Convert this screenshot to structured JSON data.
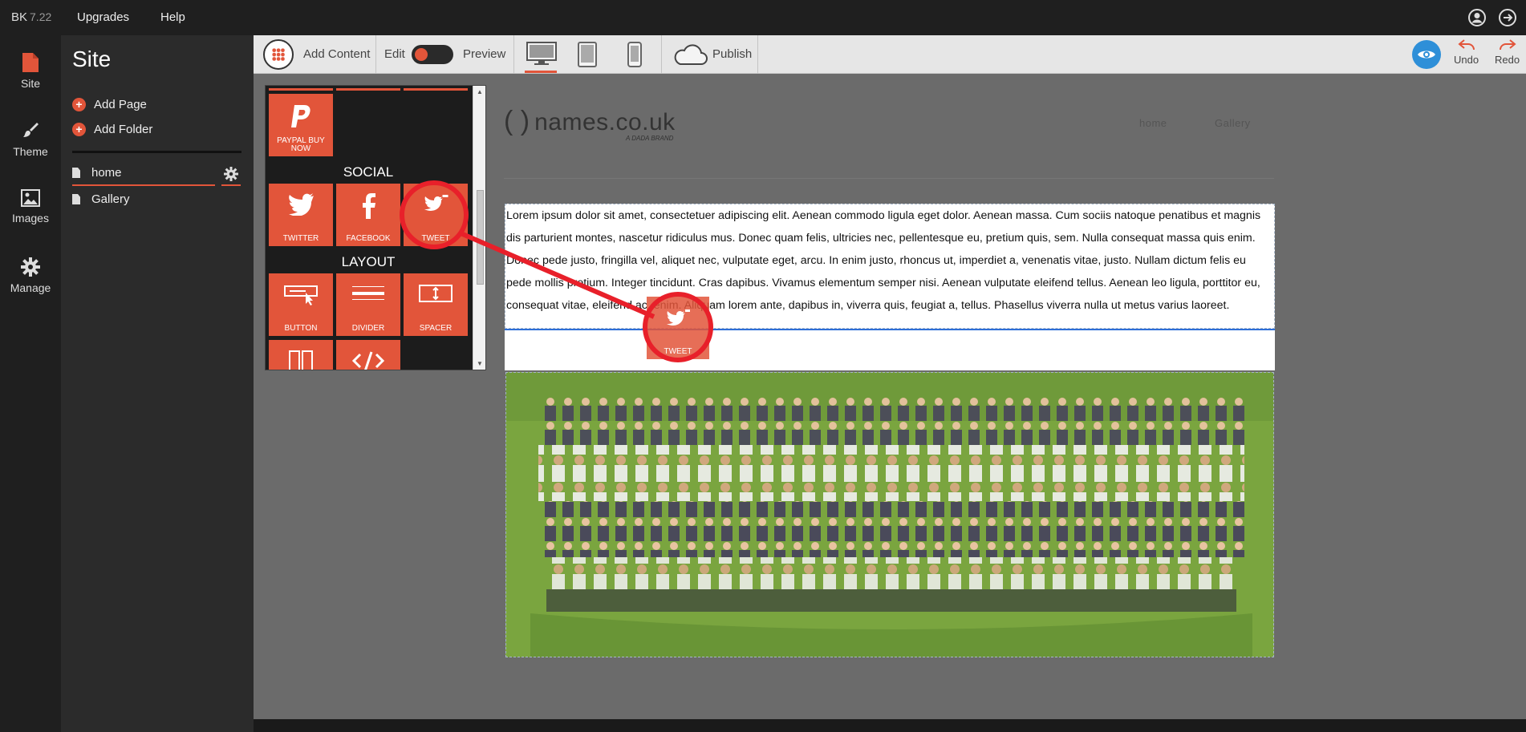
{
  "topbar": {
    "brand": "BK",
    "version": "7.22",
    "menu": [
      "Upgrades",
      "Help"
    ]
  },
  "leftnav": {
    "items": [
      {
        "label": "Site",
        "icon": "site-file-icon"
      },
      {
        "label": "Theme",
        "icon": "brush-icon"
      },
      {
        "label": "Images",
        "icon": "image-icon"
      },
      {
        "label": "Manage",
        "icon": "gear-icon"
      }
    ]
  },
  "site_panel": {
    "title": "Site",
    "add_page": "Add Page",
    "add_folder": "Add Folder",
    "pages": [
      "home",
      "Gallery"
    ]
  },
  "toolbar": {
    "add_content": "Add Content",
    "edit": "Edit",
    "preview": "Preview",
    "publish": "Publish",
    "undo": "Undo",
    "redo": "Redo"
  },
  "palette": {
    "paypal_label": "PAYPAL BUY NOW",
    "social_heading": "SOCIAL",
    "social": [
      "TWITTER",
      "FACEBOOK",
      "TWEET"
    ],
    "layout_heading": "LAYOUT",
    "layout": [
      "BUTTON",
      "DIVIDER",
      "SPACER"
    ]
  },
  "canvas": {
    "logo_text": "names.co.uk",
    "logo_sub": "A DADA BRAND",
    "nav": [
      "home",
      "Gallery"
    ],
    "paragraph": "Lorem ipsum dolor sit amet, consectetuer adipiscing elit. Aenean commodo ligula eget dolor. Aenean massa. Cum sociis natoque penatibus et magnis dis parturient montes, nascetur ridiculus mus. Donec quam felis, ultricies nec, pellentesque eu, pretium quis, sem. Nulla consequat massa quis enim. Donec pede justo, fringilla vel, aliquet nec, vulputate eget, arcu. In enim justo, rhoncus ut, imperdiet a, venenatis vitae, justo. Nullam dictum felis eu pede mollis pretium. Integer tincidunt. Cras dapibus. Vivamus elementum semper nisi. Aenean vulputate eleifend tellus. Aenean leo ligula, porttitor eu, consequat vitae, eleifend ac, enim. Aliquam lorem ante, dapibus in, viverra quis, feugiat a, tellus. Phasellus viverra nulla ut metus varius laoreet.",
    "drag_ghost_label": "TWEET"
  },
  "colors": {
    "accent": "#e2553a",
    "highlight_circle": "#e8202a",
    "drop_line": "#2e6fd8"
  }
}
